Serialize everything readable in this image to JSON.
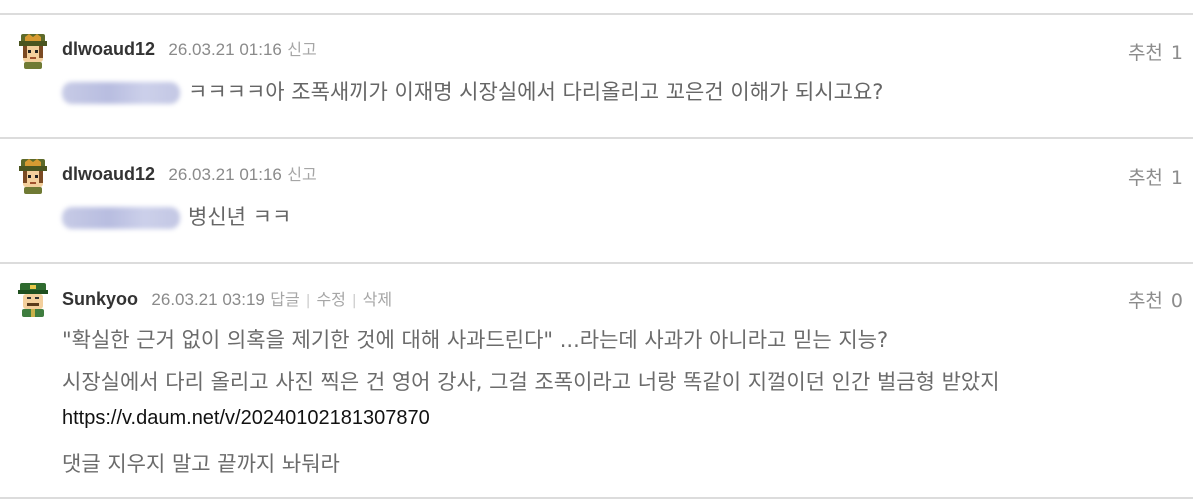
{
  "comments": [
    {
      "author": "dlwoaud12",
      "date": "26.03.21 01:16",
      "actions": [
        "신고"
      ],
      "recommend_label": "추천",
      "recommend_count": "1",
      "text": "ㅋㅋㅋㅋ아 조폭새끼가 이재명 시장실에서 다리올리고 꼬은건 이해가 되시고요?"
    },
    {
      "author": "dlwoaud12",
      "date": "26.03.21 01:16",
      "actions": [
        "신고"
      ],
      "recommend_label": "추천",
      "recommend_count": "1",
      "text": "병신년 ㅋㅋ"
    },
    {
      "author": "Sunkyoo",
      "date": "26.03.21 03:19",
      "actions": [
        "답글",
        "수정",
        "삭제"
      ],
      "recommend_label": "추천",
      "recommend_count": "0",
      "lines": [
        "\"확실한 근거 없이 의혹을 제기한 것에 대해 사과드린다\" ...라는데 사과가 아니라고 믿는 지능?",
        "시장실에서 다리 올리고 사진 찍은 건 영어 강사, 그걸 조폭이라고 너랑 똑같이 지껄이던 인간 벌금형 받았지",
        "https://v.daum.net/v/20240102181307870",
        "댓글 지우지 말고 끝까지 놔둬라"
      ]
    }
  ],
  "colors": {
    "author": "#333333",
    "date": "#8a8a8a",
    "action": "#a6a6a6",
    "body": "#666666",
    "link": "#111111",
    "separator": "#dcdcdc"
  }
}
